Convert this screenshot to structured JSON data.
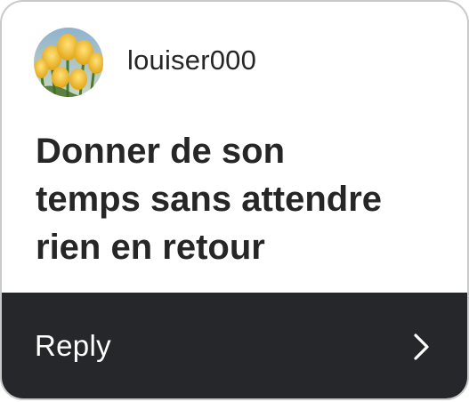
{
  "user": {
    "username": "louiser000",
    "avatar_icon": "tulips-avatar"
  },
  "question": {
    "lines": [
      "Donner de son",
      "temps sans attendre",
      "rien en retour"
    ]
  },
  "footer": {
    "reply_label": "Reply",
    "chevron_icon": "chevron-right-icon"
  },
  "colors": {
    "footer_background": "#26272b",
    "text": "#262626",
    "card_border": "#c9c9c9"
  }
}
